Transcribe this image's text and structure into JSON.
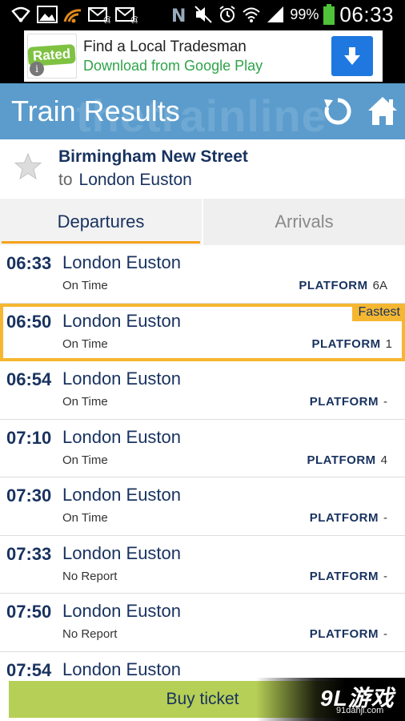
{
  "status_bar": {
    "battery_pct": "99%",
    "time": "06:33",
    "icons": [
      "wifi-icon",
      "image-icon",
      "rss-icon",
      "email-icon",
      "email-icon",
      "nfc-icon",
      "mute-icon",
      "alarm-icon",
      "wifi-signal-icon",
      "cell-signal-icon",
      "battery-icon"
    ]
  },
  "ad": {
    "logo_text": "Rated",
    "title": "Find a Local Tradesman",
    "subtitle": "Download from Google Play",
    "info_glyph": "i",
    "accent_color": "#1e78e0"
  },
  "header": {
    "title": "Train Results",
    "watermark": "thetrainline",
    "background": "#5b9ccd"
  },
  "journey": {
    "origin": "Birmingham New Street",
    "to_label": "to",
    "destination": "London Euston"
  },
  "tabs": [
    {
      "label": "Departures",
      "selected": true
    },
    {
      "label": "Arrivals",
      "selected": false
    }
  ],
  "results": [
    {
      "time": "06:33",
      "destination": "London Euston",
      "status": "On Time",
      "platform_label": "PLATFORM",
      "platform": "6A",
      "fastest": false
    },
    {
      "time": "06:50",
      "destination": "London Euston",
      "status": "On Time",
      "platform_label": "PLATFORM",
      "platform": "1",
      "fastest": true,
      "badge": "Fastest"
    },
    {
      "time": "06:54",
      "destination": "London Euston",
      "status": "On Time",
      "platform_label": "PLATFORM",
      "platform": "-",
      "fastest": false
    },
    {
      "time": "07:10",
      "destination": "London Euston",
      "status": "On Time",
      "platform_label": "PLATFORM",
      "platform": "4",
      "fastest": false
    },
    {
      "time": "07:30",
      "destination": "London Euston",
      "status": "On Time",
      "platform_label": "PLATFORM",
      "platform": "-",
      "fastest": false
    },
    {
      "time": "07:33",
      "destination": "London Euston",
      "status": "No Report",
      "platform_label": "PLATFORM",
      "platform": "-",
      "fastest": false
    },
    {
      "time": "07:50",
      "destination": "London Euston",
      "status": "No Report",
      "platform_label": "PLATFORM",
      "platform": "-",
      "fastest": false
    },
    {
      "time": "07:54",
      "destination": "London Euston",
      "status": "",
      "platform_label": "",
      "platform": "",
      "fastest": false
    }
  ],
  "buy_button": {
    "label": "Buy ticket",
    "color": "#b6cf56"
  },
  "watermark": {
    "logo": "9L游戏",
    "url": "91danji.com"
  }
}
